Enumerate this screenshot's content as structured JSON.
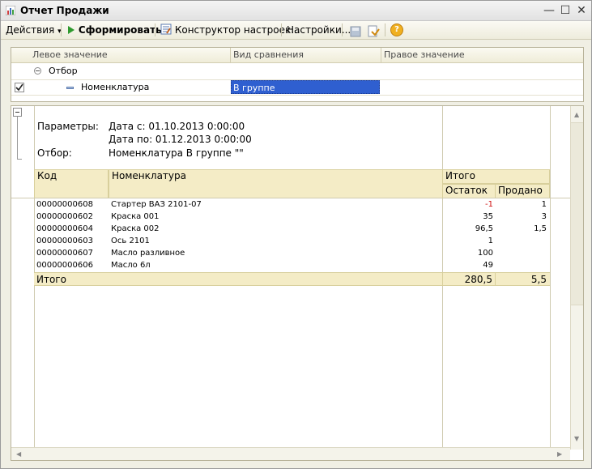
{
  "window": {
    "title": "Отчет  Продажи",
    "minimize": "—",
    "maximize": "☐",
    "close": "✕"
  },
  "toolbar": {
    "actions": "Действия",
    "actions_arrow": "▾",
    "generate": "Сформировать",
    "constructor": "Конструктор настроек...",
    "settings": "Настройки...",
    "help": "?"
  },
  "filter": {
    "headers": {
      "left": "Левое значение",
      "compare": "Вид сравнения",
      "right": "Правое значение"
    },
    "group_label": "Отбор",
    "row": {
      "checked": true,
      "left": "Номенклатура",
      "compare": "В группе",
      "right": ""
    }
  },
  "report": {
    "params_label": "Параметры:",
    "date_from": "Дата с: 01.10.2013 0:00:00",
    "date_to": "Дата по: 01.12.2013 0:00:00",
    "filter_label": "Отбор:",
    "filter_value": "Номенклатура В группе \"\"",
    "headers": {
      "code": "Код",
      "name": "Номенклатура",
      "total": "Итого",
      "balance": "Остаток",
      "sold": "Продано"
    },
    "rows": [
      {
        "code": "00000000608",
        "name": "Стартер ВАЗ 2101-07",
        "balance": "-1",
        "sold": "1"
      },
      {
        "code": "00000000602",
        "name": "Краска 001",
        "balance": "35",
        "sold": "3"
      },
      {
        "code": "00000000604",
        "name": "Краска 002",
        "balance": "96,5",
        "sold": "1,5"
      },
      {
        "code": "00000000603",
        "name": "Ось 2101",
        "balance": "1",
        "sold": ""
      },
      {
        "code": "00000000607",
        "name": "Масло разливное",
        "balance": "100",
        "sold": ""
      },
      {
        "code": "00000000606",
        "name": "Масло 6л",
        "balance": "49",
        "sold": ""
      }
    ],
    "total": {
      "label": "Итого",
      "balance": "280,5",
      "sold": "5,5"
    }
  },
  "colors": {
    "accent_green": "#2e9a2e",
    "header_fill": "#f4ecc6",
    "negative": "#d01010",
    "selection": "#2f5fd0"
  }
}
